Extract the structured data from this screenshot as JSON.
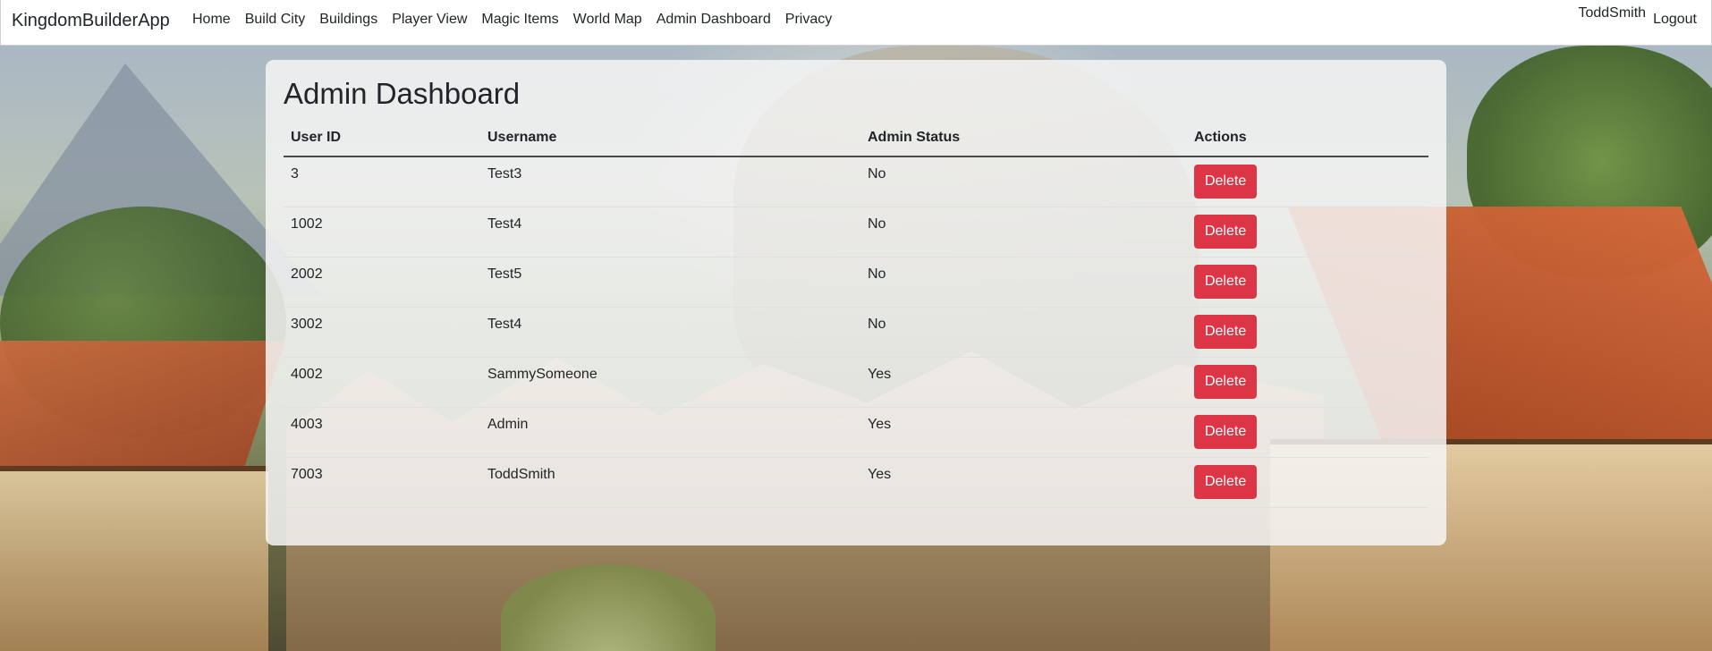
{
  "app": {
    "brand": "KingdomBuilderApp"
  },
  "nav": {
    "links": [
      {
        "label": "Home"
      },
      {
        "label": "Build City"
      },
      {
        "label": "Buildings"
      },
      {
        "label": "Player View"
      },
      {
        "label": "Magic Items"
      },
      {
        "label": "World Map"
      },
      {
        "label": "Admin Dashboard"
      },
      {
        "label": "Privacy"
      }
    ],
    "user": "ToddSmith",
    "logout": "Logout"
  },
  "main": {
    "title": "Admin Dashboard",
    "table": {
      "headers": [
        "User ID",
        "Username",
        "Admin Status",
        "Actions"
      ],
      "rows": [
        {
          "id": "3",
          "username": "Test3",
          "admin": "No",
          "action": "Delete"
        },
        {
          "id": "1002",
          "username": "Test4",
          "admin": "No",
          "action": "Delete"
        },
        {
          "id": "2002",
          "username": "Test5",
          "admin": "No",
          "action": "Delete"
        },
        {
          "id": "3002",
          "username": "Test4",
          "admin": "No",
          "action": "Delete"
        },
        {
          "id": "4002",
          "username": "SammySomeone",
          "admin": "Yes",
          "action": "Delete"
        },
        {
          "id": "4003",
          "username": "Admin",
          "admin": "Yes",
          "action": "Delete"
        },
        {
          "id": "7003",
          "username": "ToddSmith",
          "admin": "Yes",
          "action": "Delete"
        }
      ]
    }
  },
  "colors": {
    "danger": "#dc3545",
    "text": "#212529",
    "panel": "#f5f5f5"
  }
}
